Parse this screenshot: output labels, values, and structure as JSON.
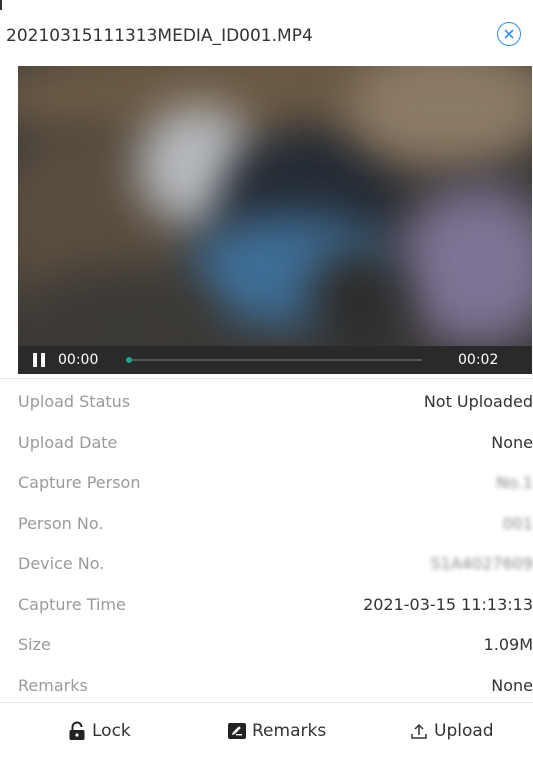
{
  "header": {
    "filename": "20210315111313MEDIA_ID001.MP4",
    "close_icon": "close-circle-icon",
    "accent_color": "#2f8ee8"
  },
  "player": {
    "current_time": "00:00",
    "total_time": "00:02",
    "progress": 0,
    "state": "playing",
    "control_icon": "pause-icon",
    "progress_color": "#1aa693"
  },
  "info": {
    "rows": [
      {
        "label": "Upload Status",
        "value": "Not Uploaded"
      },
      {
        "label": "Upload Date",
        "value": "None"
      },
      {
        "label": "Capture Person",
        "value": "No.1"
      },
      {
        "label": "Person No.",
        "value": "001"
      },
      {
        "label": "Device No.",
        "value": "S1A4027609"
      },
      {
        "label": "Capture Time",
        "value": "2021-03-15 11:13:13"
      },
      {
        "label": "Size",
        "value": "1.09M"
      },
      {
        "label": "Remarks",
        "value": "None"
      }
    ]
  },
  "actions": {
    "lock_label": "Lock",
    "lock_icon": "lock-icon",
    "remarks_label": "Remarks",
    "remarks_icon": "edit-icon",
    "upload_label": "Upload",
    "upload_icon": "upload-icon"
  }
}
